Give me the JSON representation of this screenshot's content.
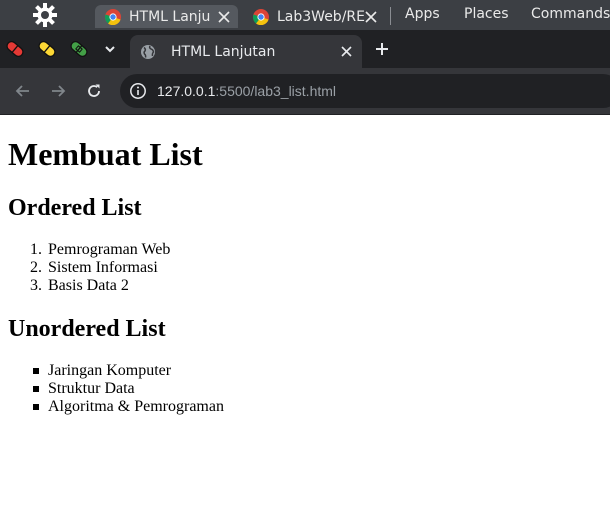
{
  "top_panel": {
    "taskbar": [
      {
        "label": "HTML Lanju",
        "icon": "chrome-icon",
        "active": true
      },
      {
        "label": "Lab3Web/RE",
        "icon": "chrome-icon",
        "active": false
      }
    ],
    "menus": [
      "Apps",
      "Places",
      "Commands"
    ]
  },
  "browser": {
    "extensions": [
      {
        "icon": "red-pill-extension-icon",
        "color": "#e53935"
      },
      {
        "icon": "yellow-pill-extension-icon",
        "color": "#fdd835"
      },
      {
        "icon": "green-pill-extension-icon",
        "color": "#43a047"
      }
    ],
    "tab": {
      "title": "HTML Lanjutan",
      "icon": "globe-icon"
    },
    "address": {
      "host": "127.0.0.1",
      "rest": ":5500/lab3_list.html"
    },
    "colors": {
      "frame": "#202124",
      "toolbar": "#35363a",
      "panel": "#3c3f44"
    }
  },
  "page": {
    "title": "Membuat List",
    "ordered_heading": "Ordered List",
    "ordered_items": [
      "Pemrograman Web",
      "Sistem Informasi",
      "Basis Data 2"
    ],
    "unordered_heading": "Unordered List",
    "unordered_items": [
      "Jaringan Komputer",
      "Struktur Data",
      "Algoritma & Pemrograman"
    ]
  }
}
